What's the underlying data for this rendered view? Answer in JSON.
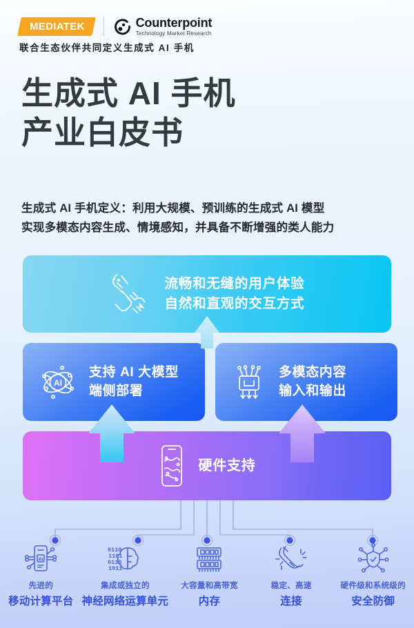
{
  "header": {
    "mediatek_logo": "MEDIATEK",
    "counterpoint_name": "Counterpoint",
    "counterpoint_tagline": "Technology Market Research",
    "subtitle": "联合生态伙伴共同定义生成式 AI 手机"
  },
  "title": {
    "line1": "生成式 AI 手机",
    "line2": "产业白皮书"
  },
  "definition": {
    "line1": "生成式 AI 手机定义：利用大规模、预训练的生成式 AI 模型",
    "line2": "实现多模态内容生成、情境感知，并具备不断增强的类人能力"
  },
  "pyramid": {
    "top": {
      "icon": "touch-gesture-icon",
      "line1": "流畅和无缝的用户体验",
      "line2": "自然和直观的交互方式",
      "color_from": "#86d7f2",
      "color_to": "#07c6f2"
    },
    "middle_left": {
      "icon": "ai-atom-icon",
      "line1": "支持 AI 大模型",
      "line2": "端侧部署",
      "color_from": "#8ab4f5",
      "color_to": "#1857ef"
    },
    "middle_right": {
      "icon": "multimodal-chip-icon",
      "line1": "多模态内容",
      "line2": "输入和输出",
      "color_from": "#8ab4f5",
      "color_to": "#1857ef"
    },
    "bottom": {
      "icon": "phone-circuit-icon",
      "label": "硬件支持",
      "color_from": "#de72f6",
      "color_to": "#5a5ff4"
    }
  },
  "features": [
    {
      "icon": "mobile-compute-platform-icon",
      "sub": "先进的",
      "main": "移动计算平台"
    },
    {
      "icon": "neural-brain-binary-icon",
      "sub": "集成或独立的",
      "main": "神经网络运算单元"
    },
    {
      "icon": "memory-chip-icon",
      "sub": "大容量和高带宽",
      "main": "内存"
    },
    {
      "icon": "connectivity-link-icon",
      "sub": "稳定、高速",
      "main": "连接"
    },
    {
      "icon": "security-shield-icon",
      "sub": "硬件级和系统级的",
      "main": "安全防御"
    }
  ],
  "colors": {
    "accent_blue": "#3450d4",
    "brand_orange": "#f5a623"
  }
}
